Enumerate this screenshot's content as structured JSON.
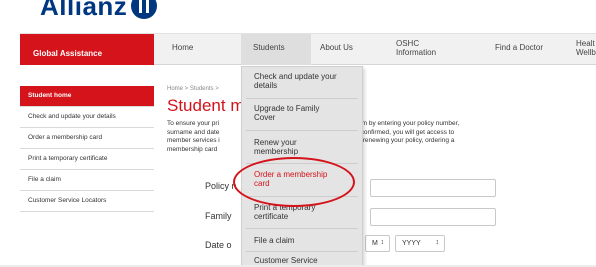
{
  "header": {
    "logo_text": "Allianz"
  },
  "nav": {
    "brand": "Global Assistance",
    "items": [
      {
        "label": "Home"
      },
      {
        "label": "Students"
      },
      {
        "label": "About Us"
      },
      {
        "label": "OSHC\nInformation"
      },
      {
        "label": "Find a Doctor"
      },
      {
        "label": "Healt\nWellb"
      }
    ]
  },
  "sidebar": {
    "items": [
      {
        "label": "Student home"
      },
      {
        "label": "Check and update your details"
      },
      {
        "label": "Order a membership card"
      },
      {
        "label": "Print a temporary certificate"
      },
      {
        "label": "File a claim"
      },
      {
        "label": "Customer Service Locators"
      }
    ]
  },
  "main": {
    "breadcrumb": "Home > Students >",
    "title": "Student m",
    "intro_lines": [
      {
        "left": "To ensure your pri",
        "right": "stem by entering your policy number,"
      },
      {
        "left": "surname and date",
        "right": "re confirmed, you will get access to"
      },
      {
        "left": "member services i",
        "right": "ils, renewing your policy, ordering a"
      },
      {
        "left": "membership card",
        "right": ""
      }
    ],
    "fields": {
      "policy_label": "Policy n",
      "family_label": "Family",
      "date_label": "Date o",
      "month_value": "M",
      "year_value": "YYYY"
    }
  },
  "dropdown": {
    "items": [
      {
        "label": "Check and update your\ndetails"
      },
      {
        "label": "Upgrade to Family\nCover"
      },
      {
        "label": "Renew your\nmembership"
      },
      {
        "label": "Order a membership\ncard"
      },
      {
        "label": "Print a temporary\ncertificate"
      },
      {
        "label": "File a claim"
      },
      {
        "label": "Customer Service"
      }
    ]
  },
  "colors": {
    "brand_red": "#d4131a",
    "logo_blue": "#003781"
  }
}
